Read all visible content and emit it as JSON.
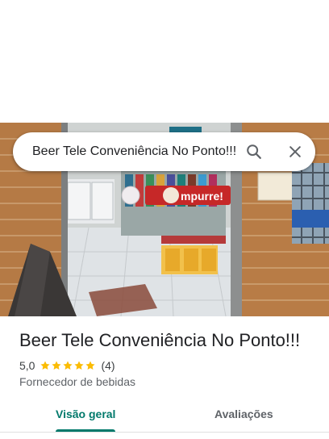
{
  "search": {
    "query": "Beer Tele Conveniência No Ponto!!!"
  },
  "icons": {
    "search": "search-icon",
    "close": "close-icon",
    "star": "star-icon"
  },
  "photo": {
    "sign_text": "mpurre!"
  },
  "place": {
    "name": "Beer Tele Conveniência No Ponto!!!",
    "rating": "5,0",
    "stars": 5,
    "review_count": "(4)",
    "category": "Fornecedor de bebidas"
  },
  "tabs": [
    {
      "label": "Visão geral",
      "active": true
    },
    {
      "label": "Avaliações",
      "active": false
    }
  ],
  "colors": {
    "accent": "#00796b",
    "star": "#fbbc04"
  }
}
